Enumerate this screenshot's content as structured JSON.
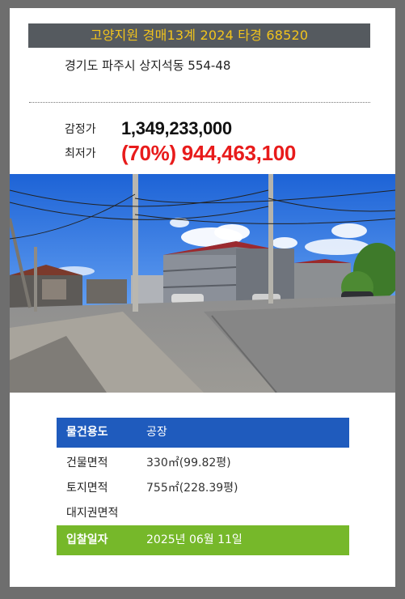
{
  "header": {
    "court_case": "고양지원 경매13계 2024 타경 68520",
    "address": "경기도 파주시 상지석동 554-48"
  },
  "prices": {
    "appraisal_label": "감정가",
    "appraisal_value": "1,349,233,000",
    "minimum_label": "최저가",
    "minimum_value": "(70%) 944,463,100"
  },
  "details": {
    "usage_label": "물건용도",
    "usage_value": "공장",
    "building_area_label": "건물면적",
    "building_area_value": "330㎡(99.82평)",
    "land_area_label": "토지면적",
    "land_area_value": "755㎡(228.39평)",
    "land_rights_label": "대지권면적",
    "land_rights_value": "",
    "bid_date_label": "입찰일자",
    "bid_date_value": "2025년 06월 11일"
  },
  "colors": {
    "header_bg": "#555a5f",
    "header_text": "#f2c41c",
    "min_price": "#e81b1b",
    "usage_bg": "#1f5bbd",
    "bid_date_bg": "#76b82a"
  }
}
